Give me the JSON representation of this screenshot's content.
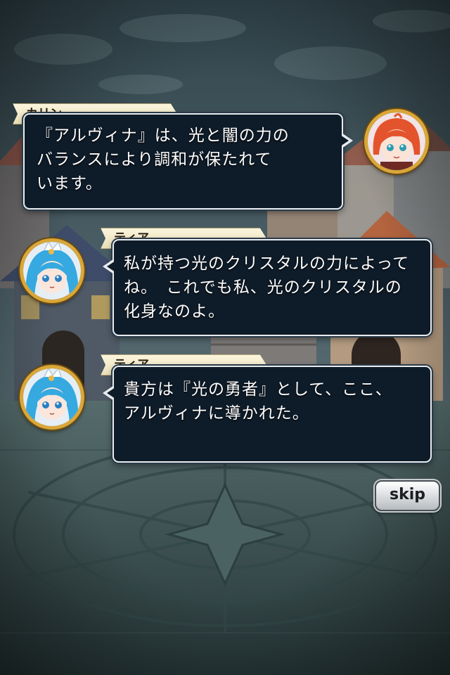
{
  "messages": [
    {
      "speaker": "カリン",
      "text": "『アルヴィナ』は、光と闇の力の\nバランスにより調和が保たれて\nいます。",
      "portrait": "karin-portrait",
      "side": "right"
    },
    {
      "speaker": "ティア",
      "text": "私が持つ光のクリスタルの力によって\nね。　これでも私、光のクリスタルの\n化身なのよ。",
      "portrait": "tia-portrait",
      "side": "left"
    },
    {
      "speaker": "ティア",
      "text": "貴方は『光の勇者』として、ここ、\nアルヴィナに導かれた。",
      "portrait": "tia-portrait",
      "side": "left"
    }
  ],
  "controls": {
    "skip_label": "skip"
  },
  "colors": {
    "bubble_bg": "#0e1b28",
    "bubble_border": "#e8ecef",
    "nameplate_bg": "#f5eccb",
    "avatar_frame": "#d9a739",
    "karin_hair": "#e3542c",
    "tia_hair": "#35a9e0"
  }
}
